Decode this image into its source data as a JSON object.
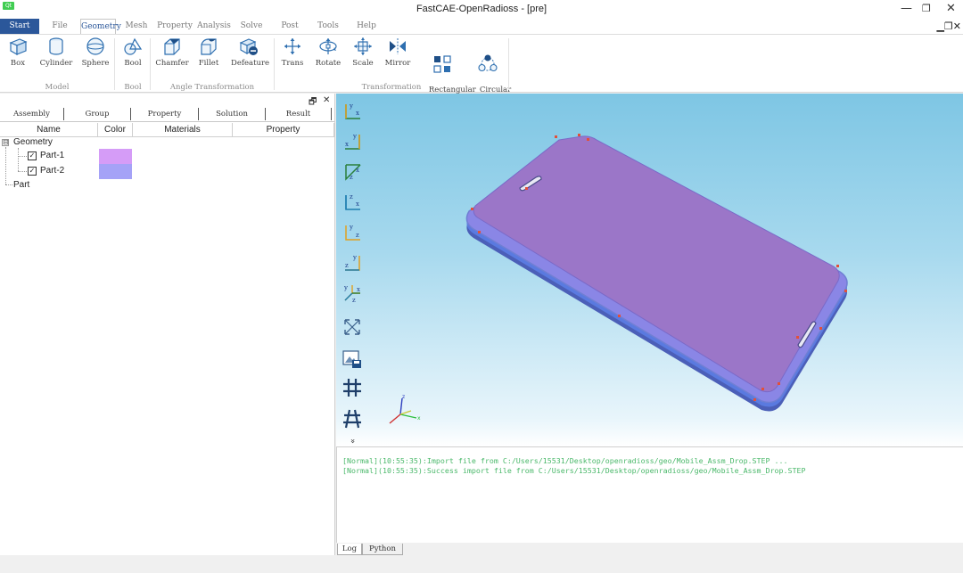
{
  "window": {
    "title": "FastCAE-OpenRadioss - [pre]",
    "qt_badge": "Qt",
    "controls": {
      "minimize": "—",
      "restore": "❐",
      "close": "✕"
    },
    "mdi_controls": "▁❐✕"
  },
  "menu": {
    "tabs": [
      "Start",
      "File",
      "Geometry",
      "Mesh",
      "Property",
      "Analysis",
      "Solve",
      "Post",
      "Tools",
      "Help"
    ],
    "active": "Geometry"
  },
  "ribbon": {
    "buttons": [
      {
        "label": "Box",
        "icon": "box-icon"
      },
      {
        "label": "Cylinder",
        "icon": "cylinder-icon"
      },
      {
        "label": "Sphere",
        "icon": "sphere-icon"
      },
      {
        "label": "Bool",
        "icon": "bool-icon"
      },
      {
        "label": "Chamfer",
        "icon": "chamfer-icon"
      },
      {
        "label": "Fillet",
        "icon": "fillet-icon"
      },
      {
        "label": "Defeature",
        "icon": "defeature-icon"
      },
      {
        "label": "Trans",
        "icon": "translate-icon"
      },
      {
        "label": "Rotate",
        "icon": "rotate-icon"
      },
      {
        "label": "Scale",
        "icon": "scale-icon"
      },
      {
        "label": "Mirror",
        "icon": "mirror-icon"
      },
      {
        "label": "Rectangular\nPattern",
        "icon": "rectangular-pattern-icon"
      },
      {
        "label": "Circular\nPattern",
        "icon": "circular-pattern-icon"
      }
    ],
    "groups": [
      "Model",
      "Bool",
      "Angle Transformation",
      "Transformation"
    ]
  },
  "left_panel": {
    "controls": {
      "float": "🗗",
      "close": "✕"
    },
    "tabs": [
      "Assembly",
      "Group",
      "Property",
      "Solution",
      "Result"
    ],
    "columns": [
      "Name",
      "Color",
      "Materials",
      "Property"
    ],
    "tree": {
      "root": "Geometry",
      "expander": "⊟",
      "items": [
        {
          "name": "Part-1",
          "checked": "✓",
          "color": "#d59cf7"
        },
        {
          "name": "Part-2",
          "checked": "✓",
          "color": "#a5a2f7"
        }
      ],
      "part_root": "Part"
    }
  },
  "viewport": {
    "view_tools": [
      "view-xy-icon",
      "view-yx-icon",
      "view-xz-icon",
      "view-zx-icon",
      "view-yz-icon",
      "view-zy-icon",
      "view-iso-icon",
      "fit-view-icon",
      "save-image-icon",
      "grid-icon",
      "grid-perspective-icon"
    ],
    "more_label": "»",
    "triad_labels": {
      "x": "x",
      "y": "y",
      "z": "z"
    },
    "model_colors": {
      "top": "#9b76c8",
      "edge": "#6f7fd4",
      "side": "#4b5fb8",
      "marker": "#e2503a"
    }
  },
  "log": {
    "lines": [
      "[Normal](10:55:35):Import file from C:/Users/15531/Desktop/openradioss/geo/Mobile_Assm_Drop.STEP ...",
      "[Normal](10:55:35):Success import file from C:/Users/15531/Desktop/openradioss/geo/Mobile_Assm_Drop.STEP"
    ],
    "tabs": [
      "Log",
      "Python"
    ]
  }
}
